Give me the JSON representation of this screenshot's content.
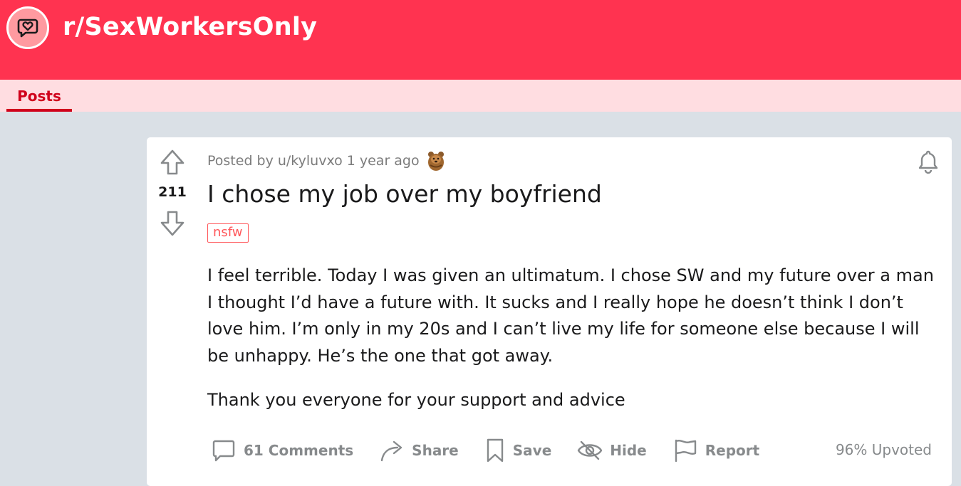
{
  "subreddit": {
    "name": "r/SexWorkersOnly",
    "icon": "chat-heart-icon",
    "banner_color": "#ff3350",
    "accent_color": "#d0021b"
  },
  "nav": {
    "tabs": [
      {
        "label": "Posts",
        "active": true
      }
    ]
  },
  "post": {
    "votes": "211",
    "posted_by_prefix": "Posted by",
    "author": "u/kyluvxo",
    "time_ago": "1 year ago",
    "award_icon": "bear-award-icon",
    "title": "I chose my job over my boyfriend",
    "flair": "nsfw",
    "body": [
      "I feel terrible. Today I was given an ultimatum. I chose SW and my future over a man I thought I’d have a future with. It sucks and I really hope he doesn’t think I don’t love him. I’m only in my 20s and I can’t live my life for someone else because I will be unhappy. He’s the one that got away.",
      "Thank you everyone for your support and advice"
    ],
    "actions": {
      "comments": "61 Comments",
      "share": "Share",
      "save": "Save",
      "hide": "Hide",
      "report": "Report"
    },
    "upvoted": "96% Upvoted"
  }
}
